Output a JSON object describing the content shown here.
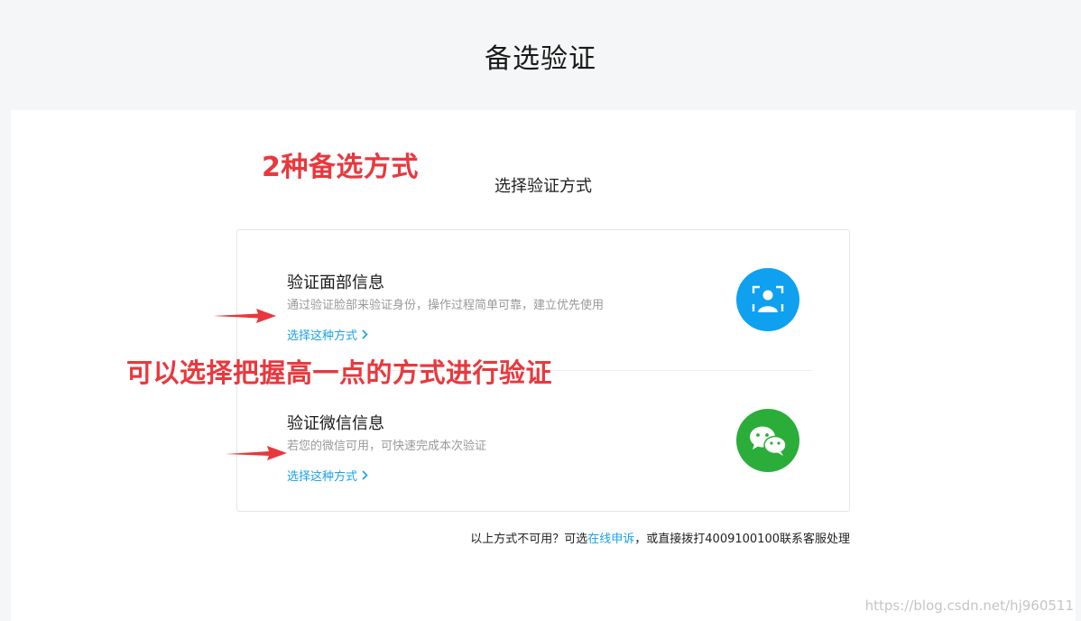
{
  "page": {
    "title": "备选验证",
    "subtitle": "选择验证方式"
  },
  "options": [
    {
      "title": "验证面部信息",
      "description": "通过验证脸部来验证身份，操作过程简单可靠，建立优先使用",
      "link_label": "选择这种方式",
      "icon": "face-scan-icon",
      "icon_color": "#0fa0f0"
    },
    {
      "title": "验证微信信息",
      "description": "若您的微信可用，可快速完成本次验证",
      "link_label": "选择这种方式",
      "icon": "wechat-icon",
      "icon_color": "#2bad3a"
    }
  ],
  "footer": {
    "prefix": "以上方式不可用？可选",
    "link": "在线申诉",
    "suffix": "，或直接拨打4009100100联系客服处理"
  },
  "annotations": {
    "note_1": "2种备选方式",
    "note_2": "可以选择把握高一点的方式进行验证",
    "color": "#e8383d"
  },
  "watermark": "https://blog.csdn.net/hj960511",
  "colors": {
    "link": "#1aa1e6",
    "background": "#f5f6f7"
  }
}
